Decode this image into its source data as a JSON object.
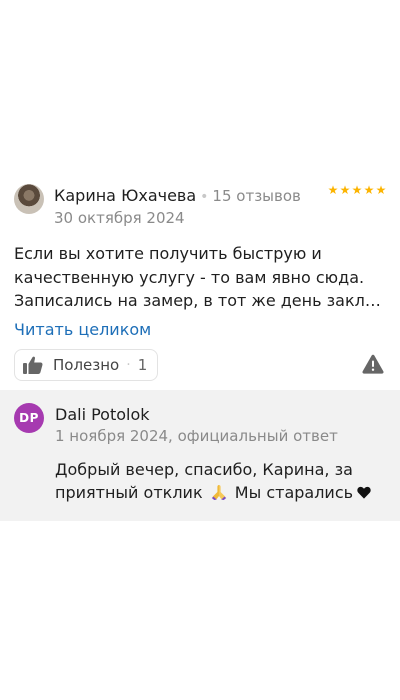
{
  "review": {
    "author_name": "Карина Юхачева",
    "separator_dot": "•",
    "reviews_count": "15 отзывов",
    "date": "30 октября 2024",
    "rating": 5,
    "text_lines": [
      "Если вы хотите получить быструю и",
      "качественную услугу - то вам явно сюда.",
      "Записались на замер, в тот же день заключи…"
    ],
    "read_more_label": "Читать целиком",
    "like_label": "Полезно",
    "like_separator": "·",
    "like_count": "1"
  },
  "reply": {
    "avatar_initials": "DP",
    "author_name": "Dali Potolok",
    "meta": "1 ноября 2024, официальный ответ",
    "text_line_1": "Добрый вечер, спасибо, Карина, за",
    "text_line_2_before": "приятный отклик",
    "text_line_2_after": "Мы старались"
  },
  "colors": {
    "star": "#fcb400",
    "link": "#1e6fb8",
    "reply_avatar": "#a63ab0",
    "reply_background": "#f2f2f2"
  },
  "icons": {
    "like": "thumbs-up-icon",
    "report": "warning-icon",
    "emoji_1": "folded-hands-emoji",
    "emoji_2": "black-heart-emoji"
  }
}
